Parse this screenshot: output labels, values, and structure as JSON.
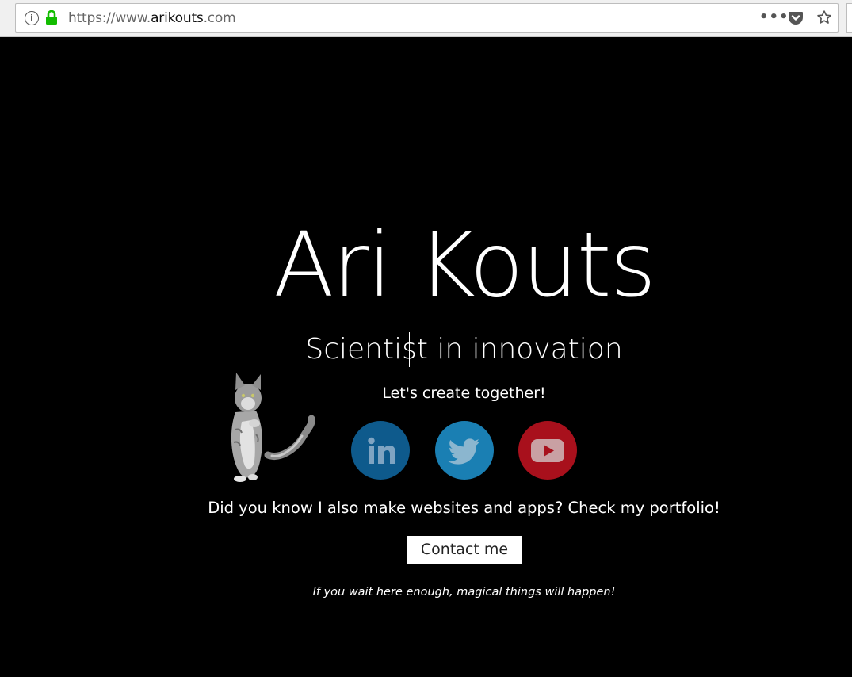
{
  "browser": {
    "url_prefix": "https://www.",
    "url_domain": "arikouts",
    "url_suffix": ".com",
    "icons": [
      "info-icon",
      "lock-icon",
      "page-actions-icon",
      "pocket-icon",
      "bookmark-star-icon"
    ]
  },
  "hero": {
    "title": "Ari Kouts",
    "subtitle": "Scientist in innovation",
    "tagline": "Let's create together!"
  },
  "social": [
    {
      "name": "linkedin",
      "icon": "linkedin-icon",
      "color": "#0e5a8c"
    },
    {
      "name": "twitter",
      "icon": "twitter-icon",
      "color": "#1a7fb3"
    },
    {
      "name": "youtube",
      "icon": "youtube-icon",
      "color": "#a8101c"
    }
  ],
  "portfolio": {
    "text": "Did you know I also make websites and apps? ",
    "link_label": "Check my portfolio!"
  },
  "contact": {
    "button_label": "Contact me"
  },
  "footnote": "If you wait here enough, magical things will happen!",
  "colors": {
    "background": "#000000",
    "text": "#ffffff",
    "lock": "#12bc00"
  }
}
